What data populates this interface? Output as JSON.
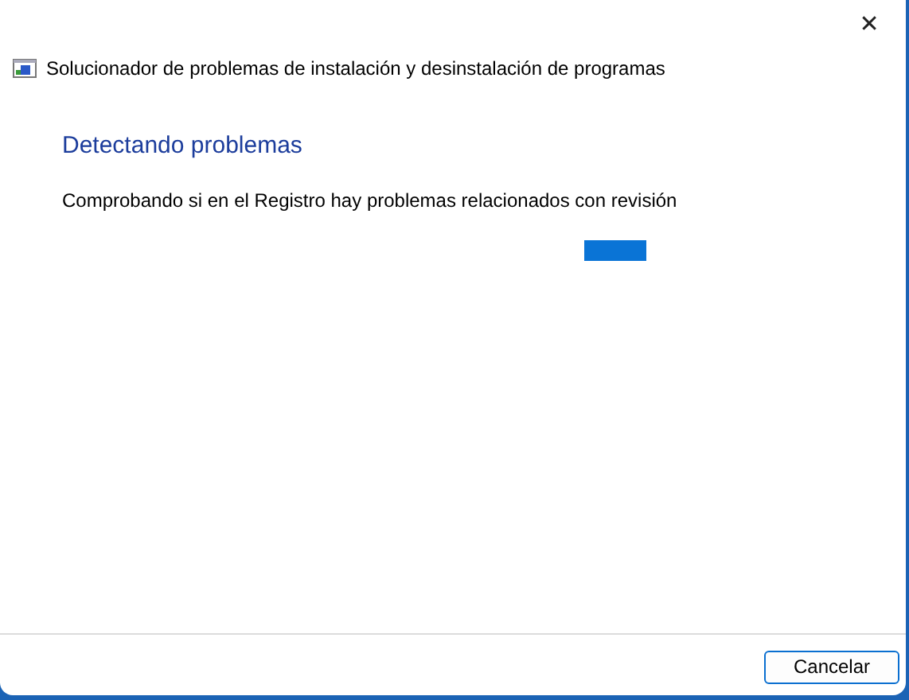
{
  "window": {
    "title": "Solucionador de problemas de instalación y desinstalación de programas",
    "close": "✕"
  },
  "heading": "Detectando problemas",
  "status": "Comprobando si en el Registro hay problemas relacionados con revisión",
  "progress": {
    "indeterminate": true
  },
  "buttons": [
    "Cancelar"
  ]
}
